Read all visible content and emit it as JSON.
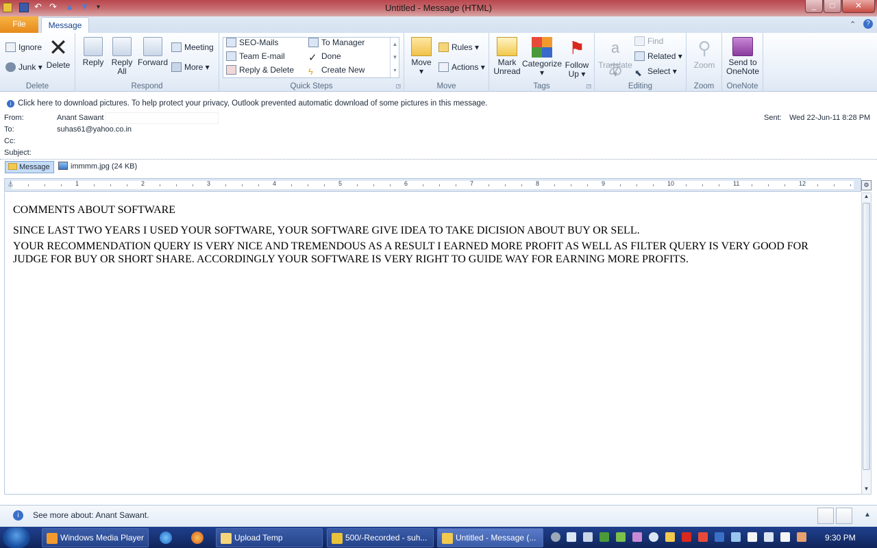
{
  "window": {
    "title": "Untitled  -  Message (HTML)"
  },
  "tabs": {
    "file": "File",
    "message": "Message"
  },
  "ribbon": {
    "delete": {
      "label": "Delete",
      "ignore": "Ignore",
      "junk": "Junk",
      "delete_btn": "Delete"
    },
    "respond": {
      "label": "Respond",
      "reply": "Reply",
      "reply_all_1": "Reply",
      "reply_all_2": "All",
      "forward": "Forward",
      "meeting": "Meeting",
      "more": "More"
    },
    "quick_steps": {
      "label": "Quick Steps",
      "items": [
        "SEO-Mails",
        "To Manager",
        "Team E-mail",
        "Done",
        "Reply & Delete",
        "Create New"
      ]
    },
    "move": {
      "label": "Move",
      "move_btn": "Move",
      "rules": "Rules",
      "actions": "Actions"
    },
    "tags": {
      "label": "Tags",
      "mark_unread_1": "Mark",
      "mark_unread_2": "Unread",
      "categorize": "Categorize",
      "follow_up_1": "Follow",
      "follow_up_2": "Up"
    },
    "editing": {
      "label": "Editing",
      "translate": "Translate",
      "find": "Find",
      "related": "Related",
      "select": "Select"
    },
    "zoom": {
      "label": "Zoom",
      "zoom_btn": "Zoom"
    },
    "onenote": {
      "label": "OneNote",
      "send_1": "Send to",
      "send_2": "OneNote"
    }
  },
  "infobar": "Click here to download pictures. To help protect your privacy, Outlook prevented automatic download of some pictures in this message.",
  "header": {
    "from_label": "From:",
    "from_value": "Anant Sawant",
    "to_label": "To:",
    "to_value": "suhas61@yahoo.co.in",
    "cc_label": "Cc:",
    "subject_label": "Subject:",
    "sent_label": "Sent:",
    "sent_value": "Wed 22-Jun-11 8:28 PM"
  },
  "attachments": {
    "message": "Message",
    "file": "immmm.jpg (24 KB)"
  },
  "ruler_numbers": [
    "1",
    "2",
    "3",
    "4",
    "5",
    "6",
    "7",
    "8",
    "9",
    "10",
    "11",
    "12"
  ],
  "body": {
    "line1": "COMMENTS ABOUT SOFTWARE",
    "line2": "SINCE LAST TWO YEARS I USED YOUR SOFTWARE, YOUR SOFTWARE GIVE IDEA TO TAKE DICISION ABOUT BUY OR SELL.",
    "line3": "YOUR RECOMMENDATION QUERY IS VERY NICE AND TREMENDOUS AS A RESULT I EARNED MORE PROFIT AS WELL AS FILTER QUERY IS VERY GOOD FOR",
    "line4": "JUDGE FOR BUY OR SHORT SHARE. ACCORDINGLY YOUR SOFTWARE IS VERY RIGHT TO GUIDE WAY FOR EARNING MORE PROFITS."
  },
  "people_pane": "See more about: Anant Sawant.",
  "taskbar": {
    "items": [
      "Windows Media Player",
      "Upload Temp",
      "500/-Recorded - suh...",
      "Untitled - Message (..."
    ],
    "clock": "9:30 PM"
  },
  "colors": {
    "file_tab": "#e78a1b",
    "titlebar": "#b8464e",
    "taskbar": "#183375",
    "ribbon": "#e9f0f9"
  }
}
